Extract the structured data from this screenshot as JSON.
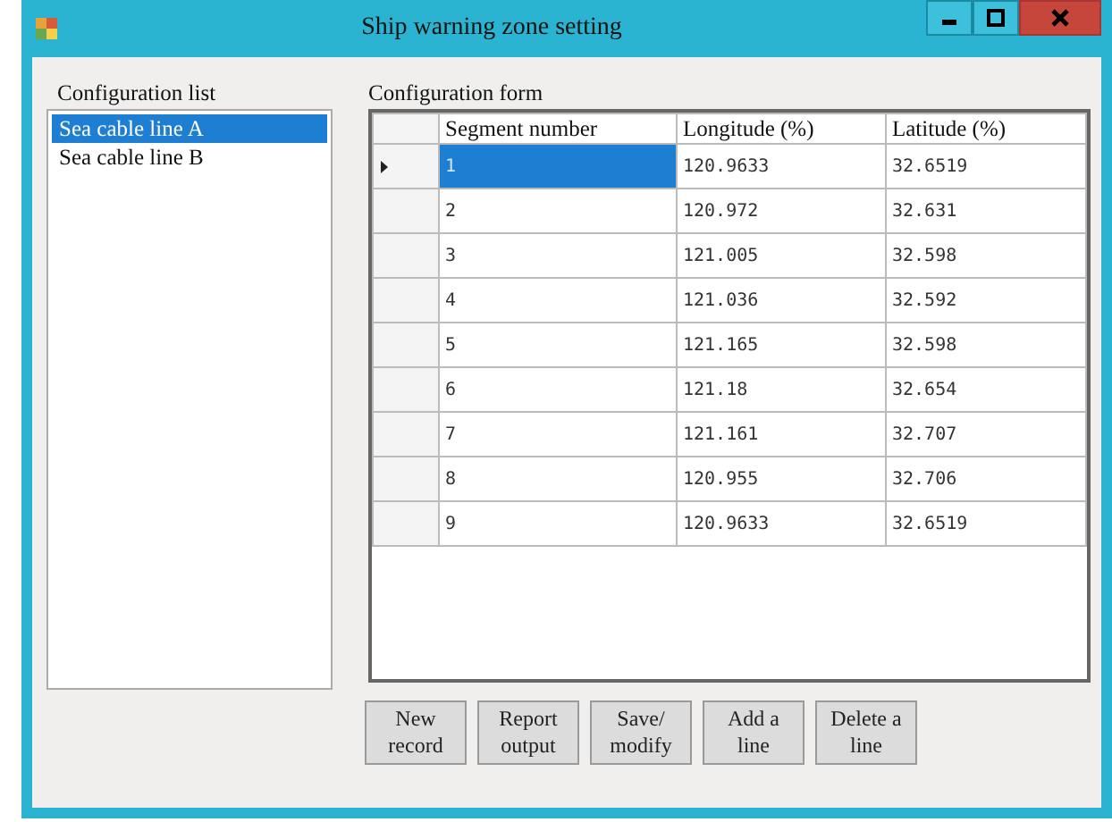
{
  "window": {
    "title": "Ship warning zone setting"
  },
  "config_list": {
    "label": "Configuration list",
    "items": [
      {
        "label": "Sea cable line A",
        "selected": true
      },
      {
        "label": "Sea cable line B",
        "selected": false
      }
    ]
  },
  "config_form": {
    "label": "Configuration form",
    "columns": [
      "Segment number",
      "Longitude (%)",
      "Latitude (%)"
    ],
    "rows": [
      {
        "cells": [
          "1",
          "120.9633",
          "32.6519"
        ],
        "selected": true
      },
      {
        "cells": [
          "2",
          "120.972",
          "32.631"
        ],
        "selected": false
      },
      {
        "cells": [
          "3",
          "121.005",
          "32.598"
        ],
        "selected": false
      },
      {
        "cells": [
          "4",
          "121.036",
          "32.592"
        ],
        "selected": false
      },
      {
        "cells": [
          "5",
          "121.165",
          "32.598"
        ],
        "selected": false
      },
      {
        "cells": [
          "6",
          "121.18",
          "32.654"
        ],
        "selected": false
      },
      {
        "cells": [
          "7",
          "121.161",
          "32.707"
        ],
        "selected": false
      },
      {
        "cells": [
          "8",
          "120.955",
          "32.706"
        ],
        "selected": false
      },
      {
        "cells": [
          "9",
          "120.9633",
          "32.6519"
        ],
        "selected": false
      }
    ]
  },
  "buttons": [
    "New record",
    "Report output",
    "Save/ modify",
    "Add a line",
    "Delete a line"
  ]
}
